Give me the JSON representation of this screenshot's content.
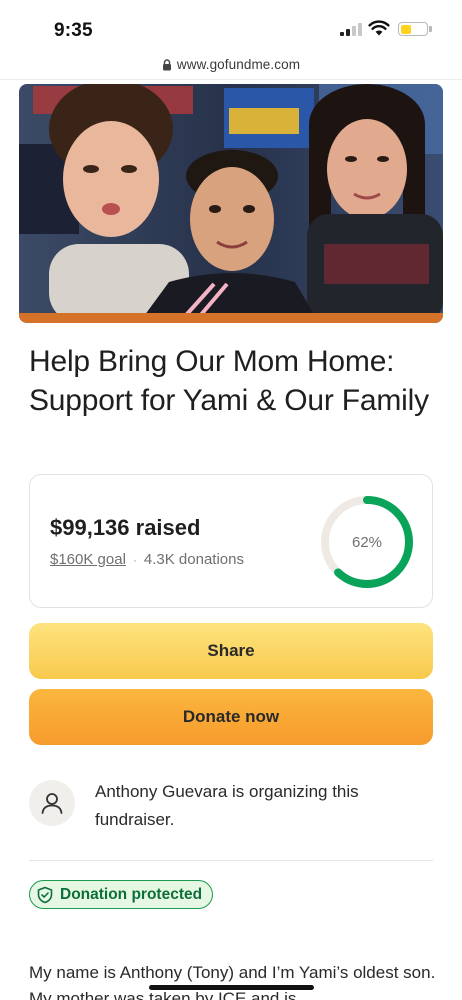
{
  "status_bar": {
    "time": "9:35"
  },
  "url_bar": {
    "url": "www.gofundme.com"
  },
  "fundraiser": {
    "title": "Help Bring Our Mom Home: Support for Yami & Our Family",
    "raised": "$99,136 raised",
    "goal": "$160K goal",
    "separator": "·",
    "donations": "4.3K donations",
    "progress_label": "62%",
    "progress_fraction": 0.62
  },
  "buttons": {
    "share_label": "Share",
    "donate_label": "Donate now"
  },
  "organizer": {
    "text": "Anthony Guevara is organizing this fundraiser."
  },
  "badge": {
    "label": "Donation protected"
  },
  "story": {
    "text": "My name is Anthony (Tony) and I’m Yami’s oldest son. My mother was taken by ICE and is"
  },
  "colors": {
    "progress_green": "#0aa35a",
    "progress_track": "#eeeae3",
    "share_yellow": "#f9d05c",
    "donate_orange": "#f7a532",
    "badge_green": "#1c9a4f",
    "badge_bg": "#e6f8e4"
  },
  "icons": {
    "lock": "lock-icon",
    "avatar": "user-icon",
    "badge": "shield-check-icon",
    "wifi": "wifi-icon",
    "signal": "cellular-signal-icon",
    "battery": "battery-icon"
  }
}
